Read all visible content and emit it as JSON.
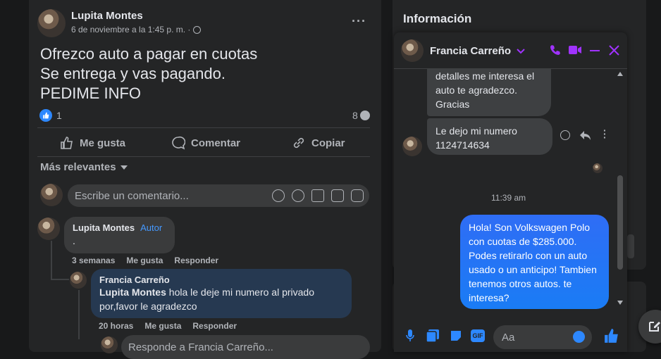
{
  "post": {
    "author": "Lupita Montes",
    "date": "6 de noviembre a la 1:45 p. m. ·",
    "privacy_icon": "globe-icon",
    "more_icon": "···",
    "text": "Ofrezco auto a pagar en cuotas\nSe entrega y vas pagando.\nPEDIME INFO",
    "likes": "1",
    "comments_count": "8",
    "actions": {
      "like": "Me gusta",
      "comment": "Comentar",
      "copy": "Copiar"
    },
    "sort_label": "Más relevantes",
    "comment_placeholder": "Escribe un comentario...",
    "comments": [
      {
        "author": "Lupita Montes",
        "badge": "Autor",
        "text": ".",
        "time": "3 semanas",
        "like": "Me gusta",
        "reply": "Responder"
      }
    ],
    "reply": {
      "author": "Francia Carreño",
      "mention": "Lupita Montes",
      "text": " hola le deje mi numero al privado por,favor le agradezco",
      "time": "20 horas",
      "like": "Me gusta",
      "reply": "Responder"
    },
    "reply_placeholder": "Responde a Francia Carreño..."
  },
  "info": {
    "title": "Información"
  },
  "chat": {
    "name": "Francia Carreño",
    "accent": "#a033ff",
    "messages_in": [
      "detalles me interesa el\nauto te agradezco.\nGracias",
      "Le dejo mi numero\n1124714634"
    ],
    "timestamp": "11:39 am",
    "message_out": "Hola! Son Volkswagen Polo con cuotas de $285.000. Podes retirarlo con un auto usado o un anticipo! Tambien tenemos otros autos. te interesa?",
    "input_placeholder": "Aa",
    "colors": {
      "bubble_mine": "#1a7cf5",
      "accent": "#a033ff",
      "blue": "#2d88ff"
    }
  }
}
